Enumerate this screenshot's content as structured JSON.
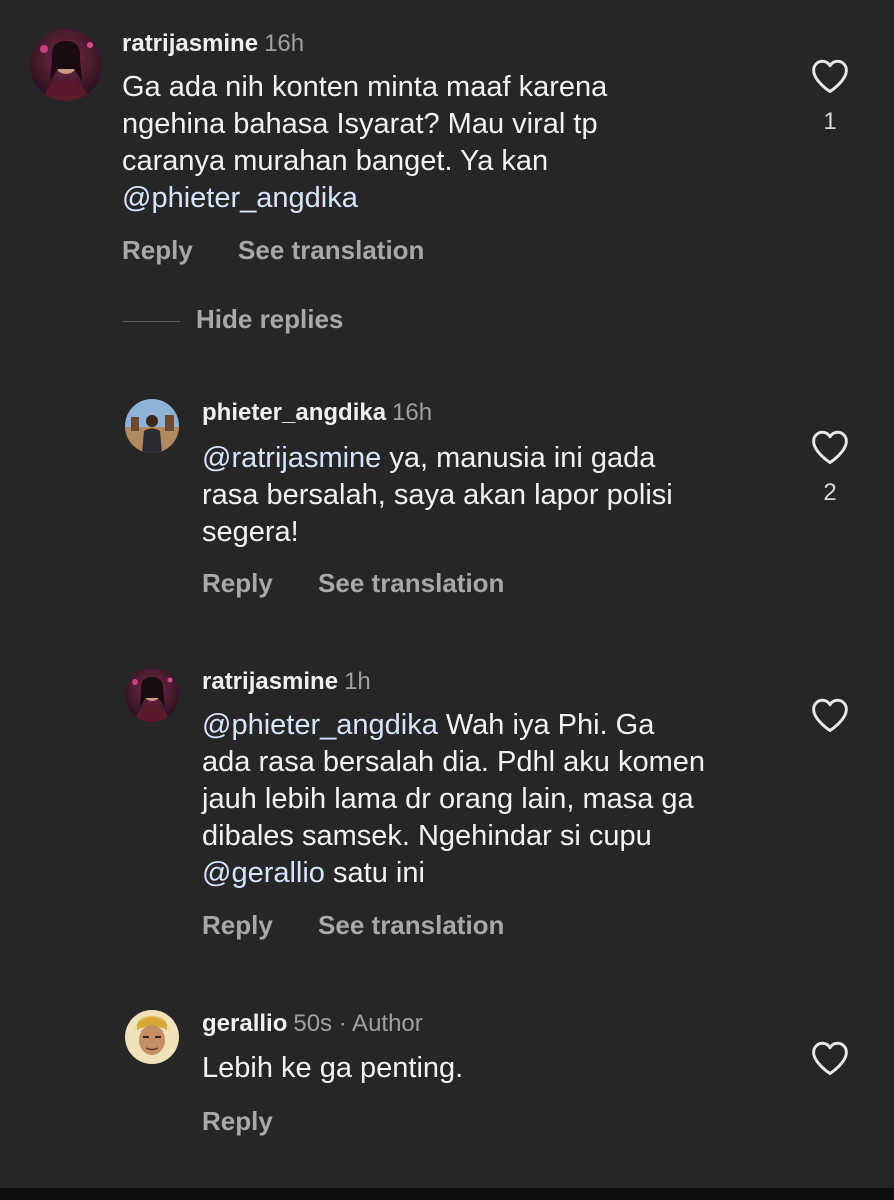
{
  "comments": [
    {
      "username": "ratrijasmine",
      "time": "16h",
      "lines": [
        "Ga ada nih konten minta maaf karena",
        "ngehina bahasa Isyarat? Mau viral tp",
        "caranya murahan banget. Ya kan"
      ],
      "mention_line": "@phieter_angdika",
      "reply_label": "Reply",
      "translate_label": "See translation",
      "like_count": "1"
    },
    {
      "username": "phieter_angdika",
      "time": "16h",
      "mention": "@ratrijasmine",
      "first_line_rest": " ya, manusia ini gada",
      "lines": [
        "rasa bersalah, saya akan lapor polisi",
        "segera!"
      ],
      "reply_label": "Reply",
      "translate_label": "See translation",
      "like_count": "2"
    },
    {
      "username": "ratrijasmine",
      "time": "1h",
      "mention": "@phieter_angdika",
      "first_line_rest": " Wah iya Phi. Ga",
      "lines": [
        "ada rasa bersalah dia. Pdhl aku komen",
        "jauh lebih lama dr orang lain, masa ga",
        "dibales samsek. Ngehindar si cupu"
      ],
      "last_mention": "@gerallio",
      "last_rest": " satu ini",
      "reply_label": "Reply",
      "translate_label": "See translation"
    },
    {
      "username": "gerallio",
      "time": "50s · Author",
      "lines": [
        "Lebih ke ga penting."
      ],
      "reply_label": "Reply"
    }
  ],
  "hide_replies_label": "Hide replies",
  "icons": {
    "like": "heart-outline-icon"
  },
  "colors": {
    "background": "#262626",
    "mention": "#d6e4ff",
    "muted": "#a8a8a8"
  }
}
